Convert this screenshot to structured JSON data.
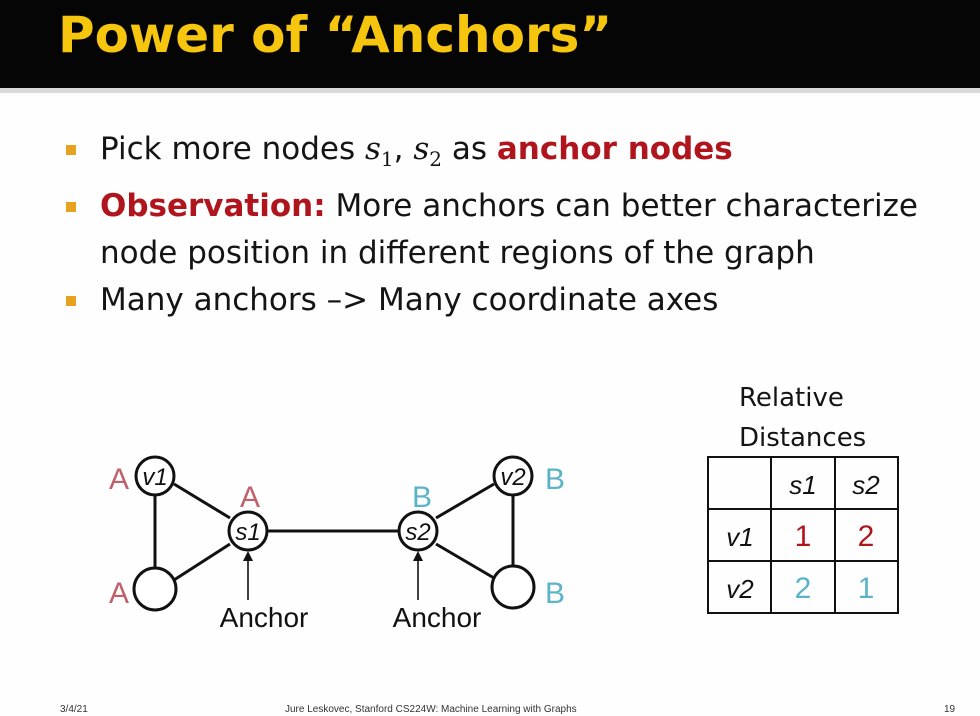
{
  "slide": {
    "title": "Power of “Anchors”",
    "bullets": {
      "b1_text": "Pick more nodes ",
      "b1_math_s1_base": "s",
      "b1_math_s1_sub": "1",
      "b1_comma": ", ",
      "b1_math_s2_base": "s",
      "b1_math_s2_sub": "2",
      "b1_as": " as ",
      "b1_highlight": "anchor nodes",
      "b2_highlight": "Observation:",
      "b2_line1": " More anchors can better characterize",
      "b2_line2": "node position in different regions of the graph",
      "b3_text": "Many anchors –> Many coordinate axes"
    }
  },
  "graph": {
    "labels": {
      "v1": "v1",
      "v2": "v2",
      "s1": "s1",
      "s2": "s2",
      "letter_a": "A",
      "letter_b": "B",
      "anchor_text": "Anchor"
    },
    "colors": {
      "a_color": "#c0606a",
      "b_color": "#5bb3c8"
    }
  },
  "table": {
    "caption_line1": "Relative",
    "caption_line2": "Distances",
    "col_headers": [
      "s1",
      "s2"
    ],
    "row_headers": [
      "v1",
      "v2"
    ],
    "cells": [
      [
        "1",
        "2"
      ],
      [
        "2",
        "1"
      ]
    ]
  },
  "footer": {
    "date": "3/4/21",
    "center": "Jure Leskovec, Stanford CS224W: Machine Learning with Graphs",
    "page": "19"
  }
}
